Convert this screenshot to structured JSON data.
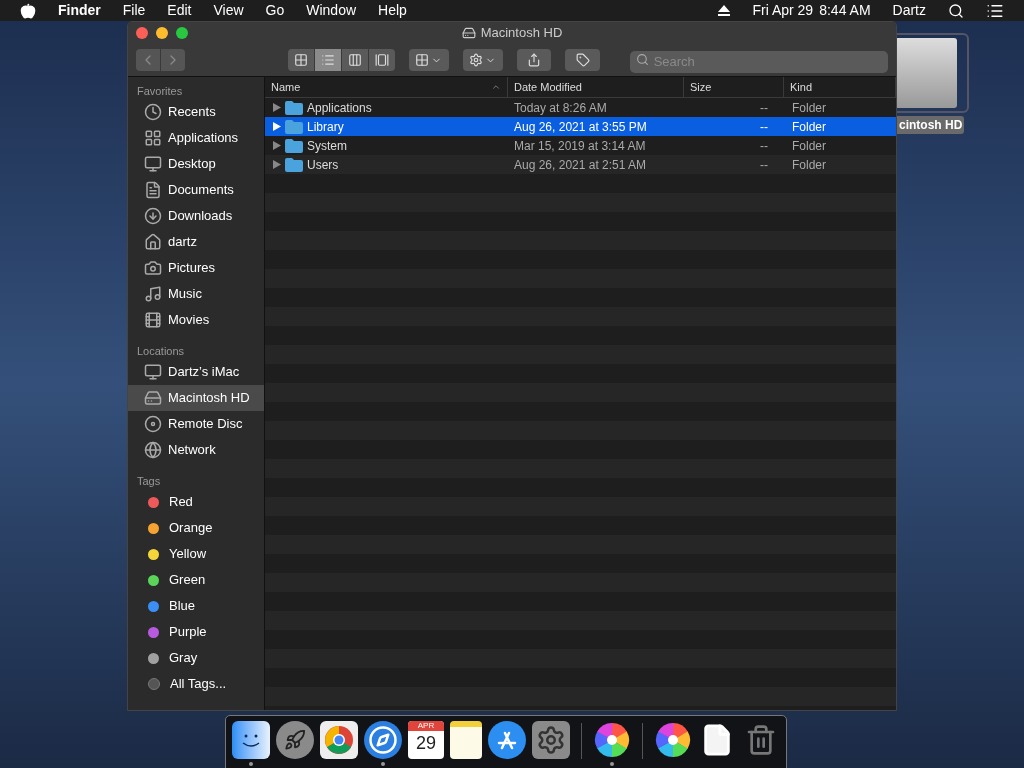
{
  "menubar": {
    "app": "Finder",
    "menus": [
      "File",
      "Edit",
      "View",
      "Go",
      "Window",
      "Help"
    ],
    "date": "Fri Apr 29",
    "time": "8:44 AM",
    "user": "Dartz"
  },
  "window": {
    "title": "Macintosh HD"
  },
  "toolbar": {
    "view_modes": [
      {
        "kind": "icons",
        "selected": false
      },
      {
        "kind": "list",
        "selected": true
      },
      {
        "kind": "columns",
        "selected": false
      },
      {
        "kind": "gallery",
        "selected": false
      }
    ],
    "search": {
      "placeholder": "Search"
    }
  },
  "sidebar": {
    "sections": [
      {
        "title": "Favorites",
        "items": [
          {
            "label": "Recents",
            "kind": "recents",
            "selected": false
          },
          {
            "label": "Applications",
            "kind": "apps",
            "selected": false
          },
          {
            "label": "Desktop",
            "kind": "desktop",
            "selected": false
          },
          {
            "label": "Documents",
            "kind": "documents",
            "selected": false
          },
          {
            "label": "Downloads",
            "kind": "downloads",
            "selected": false
          },
          {
            "label": "dartz",
            "kind": "home",
            "selected": false
          },
          {
            "label": "Pictures",
            "kind": "pictures",
            "selected": false
          },
          {
            "label": "Music",
            "kind": "music",
            "selected": false
          },
          {
            "label": "Movies",
            "kind": "movies",
            "selected": false
          }
        ]
      },
      {
        "title": "Locations",
        "items": [
          {
            "label": "Dartz’s iMac",
            "kind": "computer",
            "selected": false
          },
          {
            "label": "Macintosh HD",
            "kind": "disk",
            "selected": true
          },
          {
            "label": "Remote Disc",
            "kind": "disc",
            "selected": false
          },
          {
            "label": "Network",
            "kind": "network",
            "selected": false
          }
        ]
      },
      {
        "title": "Tags",
        "items": [
          {
            "label": "Red",
            "kind": "tag",
            "color": "#ee5a5a",
            "selected": false
          },
          {
            "label": "Orange",
            "kind": "tag",
            "color": "#f5a232",
            "selected": false
          },
          {
            "label": "Yellow",
            "kind": "tag",
            "color": "#f5d63a",
            "selected": false
          },
          {
            "label": "Green",
            "kind": "tag",
            "color": "#5ad55a",
            "selected": false
          },
          {
            "label": "Blue",
            "kind": "tag",
            "color": "#3a8ef5",
            "selected": false
          },
          {
            "label": "Purple",
            "kind": "tag",
            "color": "#b75ae0",
            "selected": false
          },
          {
            "label": "Gray",
            "kind": "tag",
            "color": "#a0a0a0",
            "selected": false
          },
          {
            "label": "All Tags...",
            "kind": "alltags",
            "selected": false
          }
        ]
      }
    ]
  },
  "table": {
    "columns": [
      "Name",
      "Date Modified",
      "Size",
      "Kind"
    ],
    "rows": [
      {
        "name": "Applications",
        "date": "Today at 8:26 AM",
        "size": "--",
        "kind": "Folder",
        "selected": false
      },
      {
        "name": "Library",
        "date": "Aug 26, 2021 at 3:55 PM",
        "size": "--",
        "kind": "Folder",
        "selected": true
      },
      {
        "name": "System",
        "date": "Mar 15, 2019 at 3:14 AM",
        "size": "--",
        "kind": "Folder",
        "selected": false
      },
      {
        "name": "Users",
        "date": "Aug 26, 2021 at 2:51 AM",
        "size": "--",
        "kind": "Folder",
        "selected": false
      }
    ]
  },
  "desktop_icon": {
    "label": "cintosh HD"
  },
  "dock": {
    "items": [
      {
        "kind": "finder",
        "running": true
      },
      {
        "kind": "launchpad",
        "running": false
      },
      {
        "kind": "chrome",
        "running": false
      },
      {
        "kind": "safari",
        "running": true
      },
      {
        "kind": "calendar",
        "month": "APR",
        "day": "29",
        "running": false
      },
      {
        "kind": "notes",
        "running": false
      },
      {
        "kind": "appstore",
        "running": false
      },
      {
        "kind": "settings",
        "running": false
      },
      {
        "kind": "separator"
      },
      {
        "kind": "pinwheel",
        "running": true
      },
      {
        "kind": "separator"
      },
      {
        "kind": "pinwheel",
        "running": false
      },
      {
        "kind": "document",
        "running": false
      },
      {
        "kind": "trash",
        "running": false
      }
    ]
  }
}
